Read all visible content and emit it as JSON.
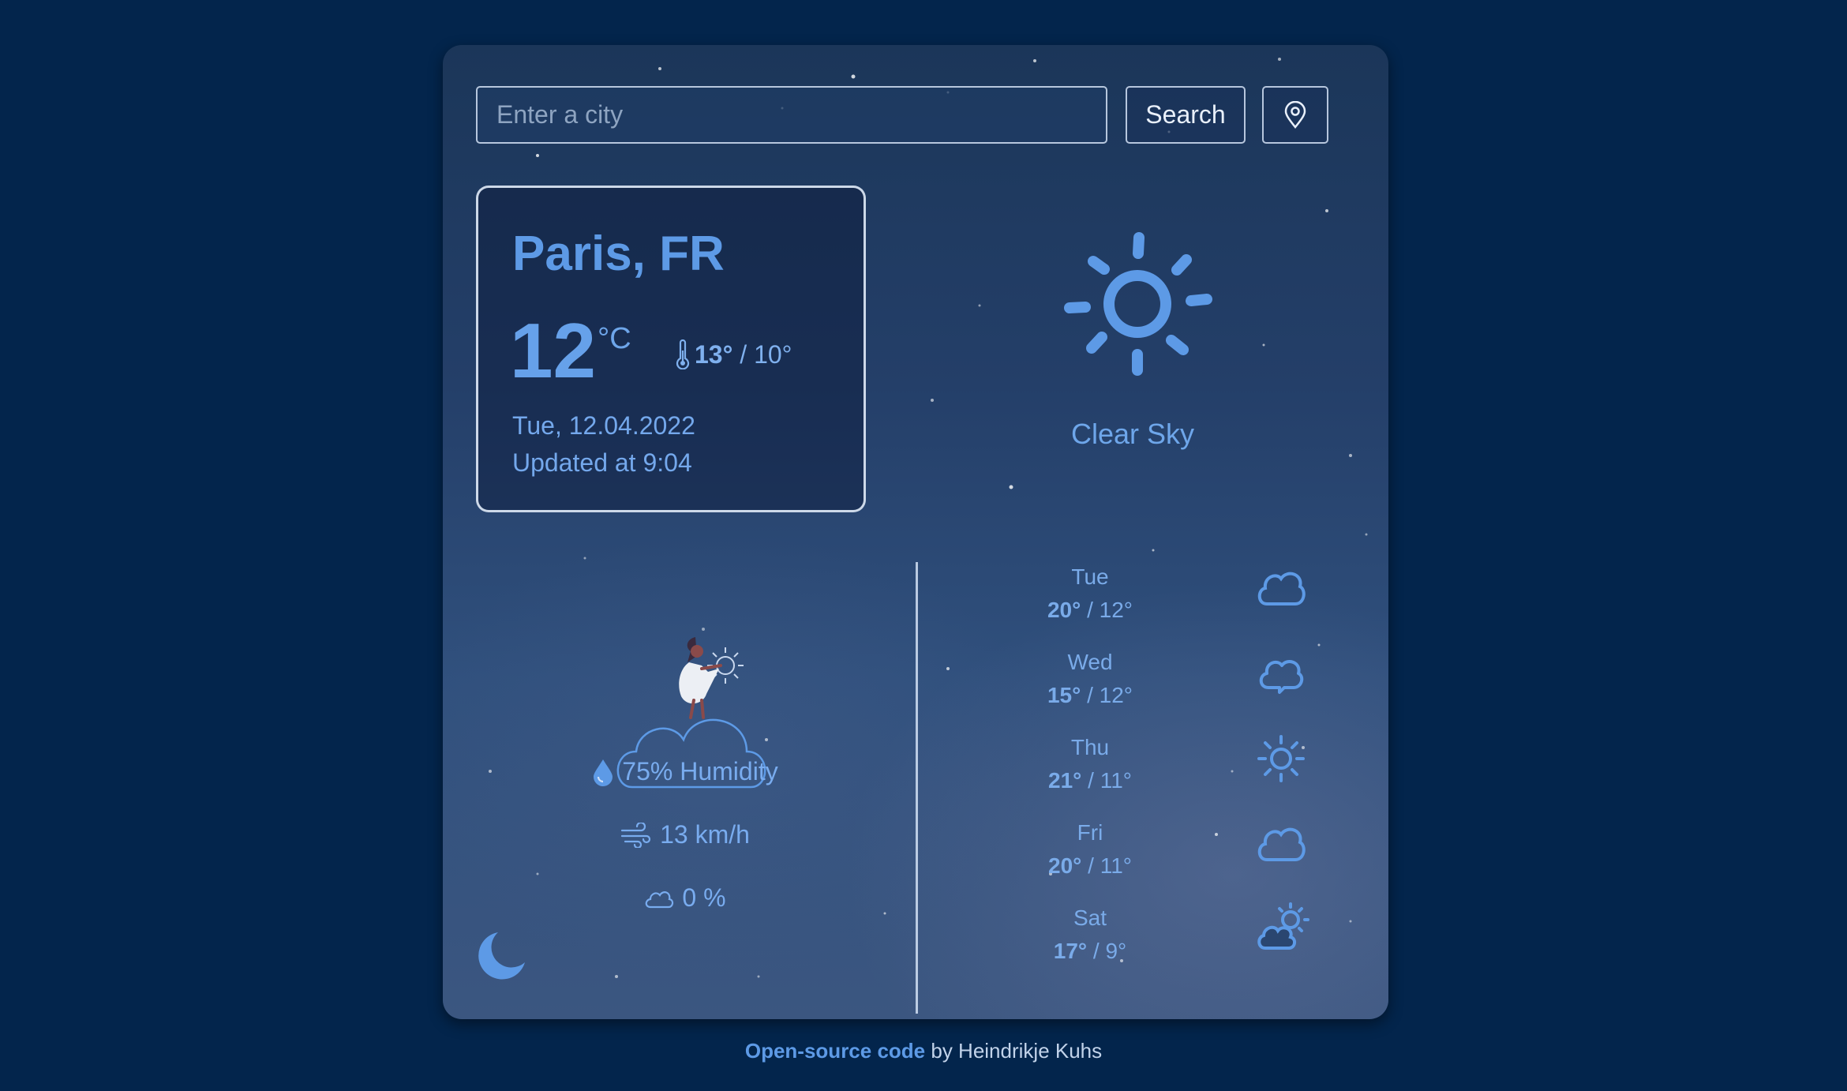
{
  "search": {
    "placeholder": "Enter a city",
    "button_label": "Search"
  },
  "current": {
    "city": "Paris, FR",
    "temperature": "12",
    "unit": "°C",
    "high": "13°",
    "low": " / 10°",
    "date": "Tue, 12.04.2022",
    "updated": "Updated at 9:04",
    "description": "Clear Sky"
  },
  "details": {
    "humidity": "75% Humidity",
    "wind": "13 km/h",
    "clouds": "0 %"
  },
  "forecast": [
    {
      "day": "Tue",
      "high": "20°",
      "low": " / 12°",
      "icon": "cloud-icon"
    },
    {
      "day": "Wed",
      "high": "15°",
      "low": " / 12°",
      "icon": "cloud-icon"
    },
    {
      "day": "Thu",
      "high": "21°",
      "low": " / 11°",
      "icon": "sun-icon"
    },
    {
      "day": "Fri",
      "high": "20°",
      "low": " / 11°",
      "icon": "cloud-icon"
    },
    {
      "day": "Sat",
      "high": "17°",
      "low": " / 9°",
      "icon": "partly-cloudy-icon"
    }
  ],
  "footer": {
    "link_text": "Open-source code",
    "text": " by Heindrikje Kuhs"
  },
  "colors": {
    "background": "#03254c",
    "accent": "#5d9ae6",
    "text_light": "#e9f0fb"
  }
}
